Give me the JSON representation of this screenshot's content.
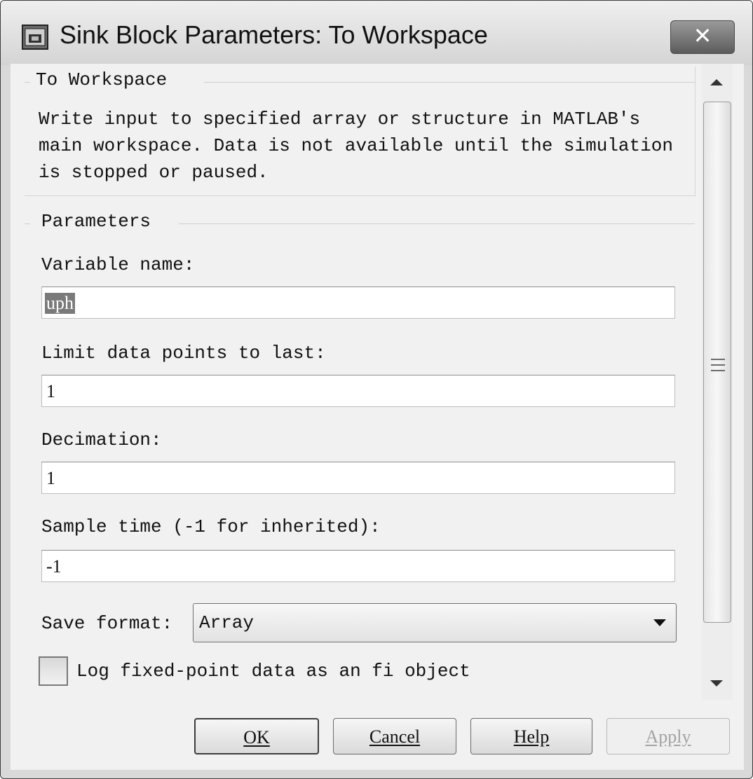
{
  "window": {
    "title": "Sink Block Parameters: To Workspace",
    "app_icon": "simulink-block-icon",
    "close_label": "✕"
  },
  "block": {
    "group_title": "To Workspace",
    "description": "Write input to specified array or structure in MATLAB's main workspace. Data is not available until the simulation is stopped or paused."
  },
  "parameters": {
    "group_title": "Parameters",
    "variable_name": {
      "label": "Variable name:",
      "value": "uph"
    },
    "limit_points": {
      "label": "Limit data points to last:",
      "value": "1"
    },
    "decimation": {
      "label": "Decimation:",
      "value": "1"
    },
    "sample_time": {
      "label": "Sample time (-1 for inherited):",
      "value": "-1"
    },
    "save_format": {
      "label": "Save format:",
      "value": "Array"
    },
    "log_fixed_point": {
      "label": "Log fixed-point data as an fi object",
      "checked": false
    }
  },
  "buttons": {
    "ok": "OK",
    "cancel": "Cancel",
    "help": "Help",
    "apply": "Apply"
  }
}
